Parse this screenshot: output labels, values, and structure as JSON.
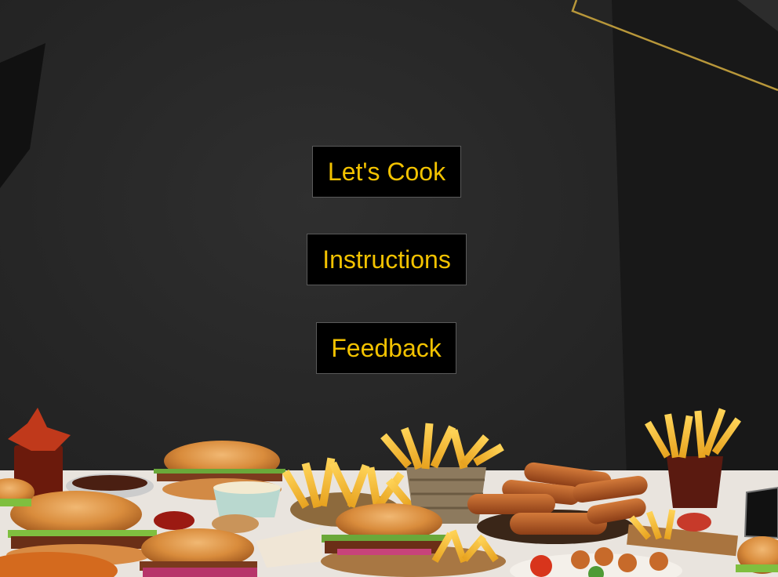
{
  "menu": {
    "lets_cook": "Let's Cook",
    "instructions": "Instructions",
    "feedback": "Feedback"
  },
  "colors": {
    "button_bg": "#000000",
    "button_text": "#f2c200",
    "accent_line": "#b8973a",
    "background": "#262626"
  }
}
